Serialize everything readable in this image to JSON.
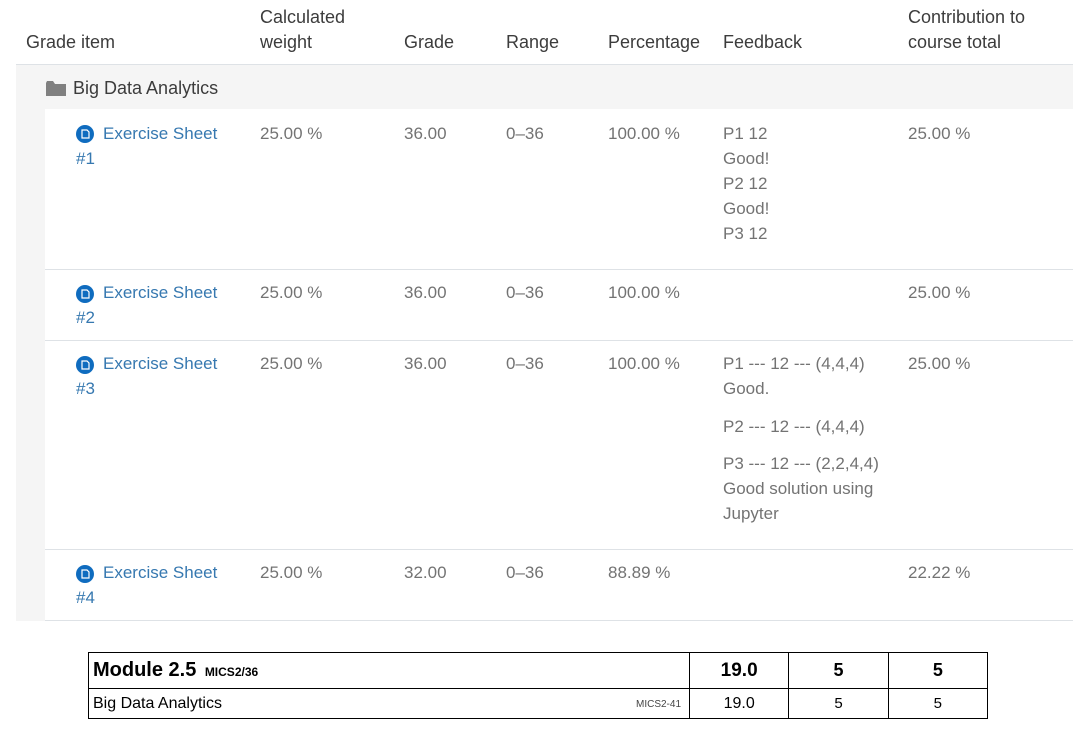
{
  "headers": {
    "grade_item": "Grade item",
    "calculated_weight": [
      "Calculated",
      "weight"
    ],
    "grade": "Grade",
    "range": "Range",
    "percentage": "Percentage",
    "feedback": "Feedback",
    "contribution": [
      "Contribution to",
      "course total"
    ]
  },
  "category": {
    "name": "Big Data Analytics"
  },
  "rows": [
    {
      "item": [
        "Exercise Sheet",
        "#1"
      ],
      "weight": "25.00 %",
      "grade": "36.00",
      "range": "0–36",
      "percentage": "100.00 %",
      "feedback": [
        "P1 12",
        "Good!",
        "P2 12",
        "Good!",
        "P3 12"
      ],
      "contribution": "25.00 %"
    },
    {
      "item": [
        "Exercise Sheet",
        "#2"
      ],
      "weight": "25.00 %",
      "grade": "36.00",
      "range": "0–36",
      "percentage": "100.00 %",
      "feedback": [],
      "contribution": "25.00 %"
    },
    {
      "item": [
        "Exercise Sheet",
        "#3"
      ],
      "weight": "25.00 %",
      "grade": "36.00",
      "range": "0–36",
      "percentage": "100.00 %",
      "feedback": [
        "P1 --- 12 --- (4,4,4)",
        "Good.",
        "P2 --- 12 ---  (4,4,4)",
        "P3 --- 12 --- (2,2,4,4)",
        "Good solution using",
        "Jupyter"
      ],
      "contribution": "25.00 %"
    },
    {
      "item": [
        "Exercise Sheet",
        "#4"
      ],
      "weight": "25.00 %",
      "grade": "32.00",
      "range": "0–36",
      "percentage": "88.89 %",
      "feedback": [],
      "contribution": "22.22 %"
    }
  ],
  "module_table": {
    "module_title": "Module 2.5",
    "module_code": "MICS2/36",
    "module_grade": "19.0",
    "module_c1": "5",
    "module_c2": "5",
    "course_name": "Big Data Analytics",
    "course_code": "MICS2-41",
    "course_grade": "19.0",
    "course_c1": "5",
    "course_c2": "5"
  }
}
